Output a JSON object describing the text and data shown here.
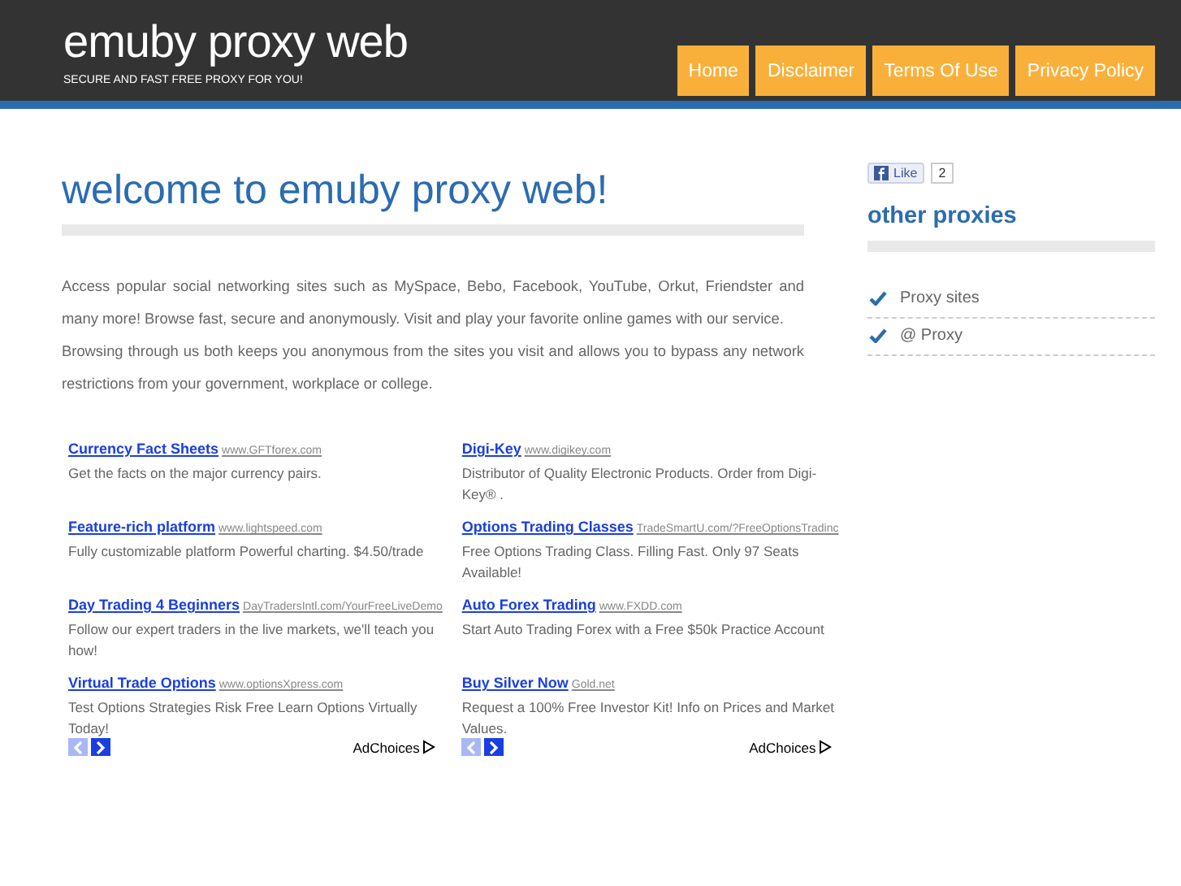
{
  "header": {
    "title": "emuby proxy web",
    "tagline": "SECURE AND FAST FREE PROXY FOR YOU!"
  },
  "nav": [
    {
      "label": "Home"
    },
    {
      "label": "Disclaimer"
    },
    {
      "label": "Terms Of Use"
    },
    {
      "label": "Privacy Policy"
    }
  ],
  "main": {
    "heading": "welcome to emuby proxy web!",
    "paragraphs": [
      "Access popular social networking sites such as MySpace, Bebo, Facebook, YouTube, Orkut, Friendster and many more! Browse fast, secure and anonymously. Visit and play your favorite online games with our service.",
      "Browsing through us both keeps you anonymous from the sites you visit and allows you to bypass any network restrictions from your government, workplace or college."
    ]
  },
  "ad_columns": [
    {
      "ads": [
        {
          "title": "Currency Fact Sheets",
          "url": "www.GFTforex.com",
          "text": "Get the facts on the major currency pairs."
        },
        {
          "title": "Feature-rich platform",
          "url": "www.lightspeed.com",
          "text": "Fully customizable platform Powerful charting. $4.50/trade"
        },
        {
          "title": "Day Trading 4 Beginners",
          "url": "DayTradersIntl.com/YourFreeLiveDemo",
          "text": "Follow our expert traders in the live markets, we'll teach you how!"
        },
        {
          "title": "Virtual Trade Options",
          "url": "www.optionsXpress.com",
          "text": "Test Options Strategies Risk Free Learn Options Virtually Today!"
        }
      ],
      "prev_disabled": true,
      "next_disabled": false,
      "adchoices": "AdChoices"
    },
    {
      "ads": [
        {
          "title": "Digi-Key",
          "url": "www.digikey.com",
          "text": "Distributor of Quality Electronic Products. Order from Digi-Key® ."
        },
        {
          "title": "Options Trading Classes",
          "url": "TradeSmartU.com/?FreeOptionsTradinc",
          "text": "Free Options Trading Class. Filling Fast. Only 97 Seats Available!"
        },
        {
          "title": "Auto Forex Trading",
          "url": "www.FXDD.com",
          "text": "Start Auto Trading Forex with a Free $50k Practice Account"
        },
        {
          "title": "Buy Silver Now",
          "url": "Gold.net",
          "text": "Request a 100% Free Investor Kit! Info on Prices and Market Values."
        }
      ],
      "prev_disabled": true,
      "next_disabled": false,
      "adchoices": "AdChoices"
    }
  ],
  "sidebar": {
    "like": {
      "label": "Like",
      "count": "2"
    },
    "heading": "other proxies",
    "links": [
      {
        "label": "Proxy sites"
      },
      {
        "label": "@ Proxy"
      }
    ]
  }
}
